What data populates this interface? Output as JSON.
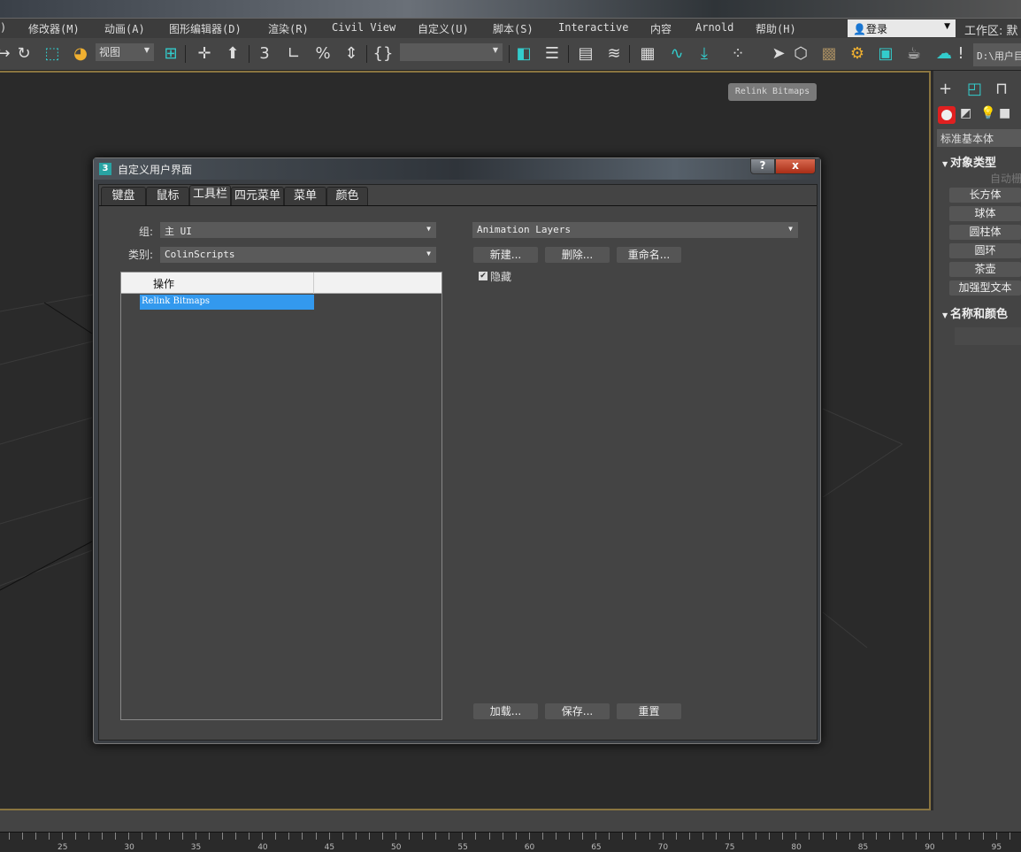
{
  "menubar": {
    "items": [
      ")",
      "修改器(M)",
      "动画(A)",
      "图形编辑器(D)",
      "渲染(R)",
      "Civil View",
      "自定义(U)",
      "脚本(S)",
      "Interactive",
      "内容",
      "Arnold",
      "帮助(H)"
    ],
    "login": "登录",
    "workspace_label": "工作区: 默"
  },
  "toolbar": {
    "view_dropdown": "视图",
    "named_selection": "",
    "path": "D:\\用户目"
  },
  "tooltip": "Relink Bitmaps",
  "command_panel": {
    "category": "标准基本体",
    "rollout_object_type": "对象类型",
    "auto_grid": "自动栅",
    "buttons": [
      "长方体",
      "球体",
      "圆柱体",
      "圆环",
      "茶壶",
      "加强型文本"
    ],
    "rollout_name_color": "名称和颜色",
    "active_color": "#e02020"
  },
  "timeline": {
    "ticks": [
      "25",
      "30",
      "35",
      "40",
      "45",
      "50",
      "55",
      "60",
      "65",
      "70",
      "75",
      "80",
      "85",
      "90",
      "95"
    ]
  },
  "dialog": {
    "title": "自定义用户界面",
    "help": "?",
    "close": "x",
    "tabs": [
      "键盘",
      "鼠标",
      "工具栏",
      "四元菜单",
      "菜单",
      "颜色"
    ],
    "active_tab": "工具栏",
    "group_label": "组:",
    "group_value": "主 UI",
    "category_label": "类别:",
    "category_value": "ColinScripts",
    "list_header": "操作",
    "list_items": [
      "Relink Bitmaps"
    ],
    "toolbar_select": "Animation Layers",
    "new": "新建...",
    "delete": "删除...",
    "rename": "重命名...",
    "hide_label": "隐藏",
    "hide_checked": true,
    "load": "加载...",
    "save": "保存...",
    "reset": "重置"
  }
}
